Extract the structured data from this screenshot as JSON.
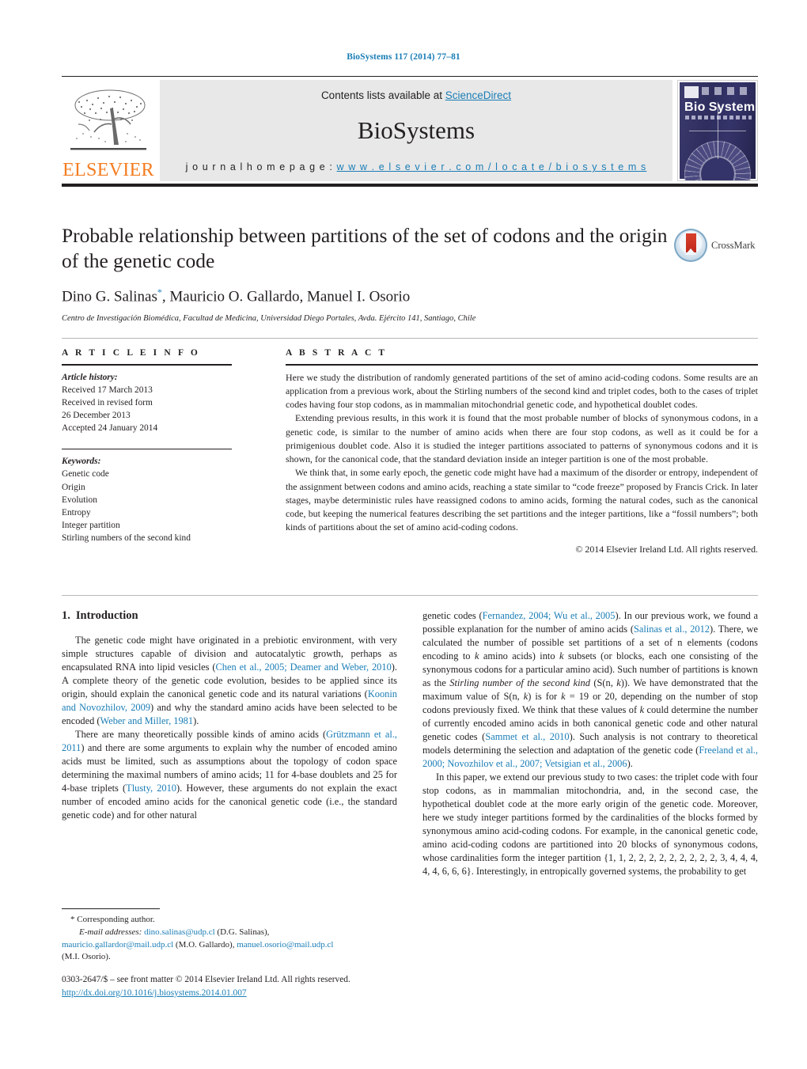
{
  "running_head": "BioSystems 117 (2014) 77–81",
  "masthead": {
    "contents_prefix": "Contents lists available at ",
    "sciencedirect": "ScienceDirect",
    "journal_name": "BioSystems",
    "homepage_prefix": "j o u r n a l   h o m e p a g e :   ",
    "homepage_url": "w w w . e l s e v i e r . c o m / l o c a t e / b i o s y s t e m s",
    "publisher_logo_text": "ELSEVIER",
    "cover_title_a": "Bio",
    "cover_title_b": "Systems",
    "accent_link": "#1a7db6",
    "accent_orange": "#f57c20"
  },
  "article": {
    "title": "Probable relationship between partitions of the set of codons and the origin of the genetic code",
    "authors": "Dino G. Salinas",
    "corresponding_marker": "*",
    "authors_rest": ", Mauricio O. Gallardo, Manuel I. Osorio",
    "affiliation": "Centro de Investigación Biomédica, Facultad de Medicina, Universidad Diego Portales, Avda. Ejército 141, Santiago, Chile",
    "crossmark_label": "CrossMark"
  },
  "article_info": {
    "heading": "A R T I C L E    I N F O",
    "history_label": "Article history:",
    "history": [
      "Received 17 March 2013",
      "Received in revised form",
      "26 December 2013",
      "Accepted 24 January 2014"
    ],
    "keywords_label": "Keywords:",
    "keywords": [
      "Genetic code",
      "Origin",
      "Evolution",
      "Entropy",
      "Integer partition",
      "Stirling numbers of the second kind"
    ]
  },
  "abstract": {
    "heading": "A B S T R A C T",
    "paragraphs": [
      "Here we study the distribution of randomly generated partitions of the set of amino acid-coding codons. Some results are an application from a previous work, about the Stirling numbers of the second kind and triplet codes, both to the cases of triplet codes having four stop codons, as in mammalian mitochondrial genetic code, and hypothetical doublet codes.",
      "Extending previous results, in this work it is found that the most probable number of blocks of synonymous codons, in a genetic code, is similar to the number of amino acids when there are four stop codons, as well as it could be for a primigenious doublet code. Also it is studied the integer partitions associated to patterns of synonymous codons and it is shown, for the canonical code, that the standard deviation inside an integer partition is one of the most probable.",
      "We think that, in some early epoch, the genetic code might have had a maximum of the disorder or entropy, independent of the assignment between codons and amino acids, reaching a state similar to “code freeze” proposed by Francis Crick. In later stages, maybe deterministic rules have reassigned codons to amino acids, forming the natural codes, such as the canonical code, but keeping the numerical features describing the set partitions and the integer partitions, like a “fossil numbers”; both kinds of partitions about the set of amino acid-coding codons."
    ],
    "copyright": "© 2014 Elsevier Ireland Ltd. All rights reserved."
  },
  "body": {
    "section_number": "1.",
    "section_title": "Introduction",
    "left_paragraphs": [
      {
        "parts": [
          {
            "t": "The genetic code might have originated in a prebiotic environment, with very simple structures capable of division and autocatalytic growth, perhaps as encapsulated RNA into lipid vesicles (",
            "k": "plain"
          },
          {
            "t": "Chen et al., 2005; Deamer and Weber, 2010",
            "k": "ref"
          },
          {
            "t": "). A complete theory of the genetic code evolution, besides to be applied since its origin, should explain the canonical genetic code and its natural variations (",
            "k": "plain"
          },
          {
            "t": "Koonin and Novozhilov, 2009",
            "k": "ref"
          },
          {
            "t": ") and why the standard amino acids have been selected to be encoded (",
            "k": "plain"
          },
          {
            "t": "Weber and Miller, 1981",
            "k": "ref"
          },
          {
            "t": ").",
            "k": "plain"
          }
        ]
      },
      {
        "parts": [
          {
            "t": "There are many theoretically possible kinds of amino acids (",
            "k": "plain"
          },
          {
            "t": "Grützmann et al., 2011",
            "k": "ref"
          },
          {
            "t": ") and there are some arguments to explain why the number of encoded amino acids must be limited, such as assumptions about the topology of codon space determining the maximal numbers of amino acids; 11 for 4-base doublets and 25 for 4-base triplets (",
            "k": "plain"
          },
          {
            "t": "Tlusty, 2010",
            "k": "ref"
          },
          {
            "t": "). However, these arguments do not explain the exact number of encoded amino acids for the canonical genetic code (i.e., the standard genetic code) and for other natural",
            "k": "plain"
          }
        ]
      }
    ],
    "right_paragraphs": [
      {
        "parts": [
          {
            "t": "genetic codes (",
            "k": "plain"
          },
          {
            "t": "Fernandez, 2004; Wu et al., 2005",
            "k": "ref"
          },
          {
            "t": "). In our previous work, we found a possible explanation for the number of amino acids (",
            "k": "plain"
          },
          {
            "t": "Salinas et al., 2012",
            "k": "ref"
          },
          {
            "t": "). There, we calculated the number of possible set partitions of a set of n elements (codons encoding to ",
            "k": "plain"
          },
          {
            "t": "k",
            "k": "it"
          },
          {
            "t": " amino acids) into ",
            "k": "plain"
          },
          {
            "t": "k",
            "k": "it"
          },
          {
            "t": " subsets (or blocks, each one consisting of the synonymous codons for a particular amino acid). Such number of partitions is known as the ",
            "k": "plain"
          },
          {
            "t": "Stirling number of the second kind",
            "k": "it"
          },
          {
            "t": " (S(n, ",
            "k": "plain"
          },
          {
            "t": "k",
            "k": "it"
          },
          {
            "t": ")). We have demonstrated that the maximum value of S(n, ",
            "k": "plain"
          },
          {
            "t": "k",
            "k": "it"
          },
          {
            "t": ") is for ",
            "k": "plain"
          },
          {
            "t": "k",
            "k": "it"
          },
          {
            "t": " = 19 or 20, depending on the number of stop codons previously fixed. We think that these values of ",
            "k": "plain"
          },
          {
            "t": "k",
            "k": "it"
          },
          {
            "t": " could determine the number of currently encoded amino acids in both canonical genetic code and other natural genetic codes (",
            "k": "plain"
          },
          {
            "t": "Sammet et al., 2010",
            "k": "ref"
          },
          {
            "t": "). Such analysis is not contrary to theoretical models determining the selection and adaptation of the genetic code (",
            "k": "plain"
          },
          {
            "t": "Freeland et al., 2000; Novozhilov et al., 2007; Vetsigian et al., 2006",
            "k": "ref"
          },
          {
            "t": ").",
            "k": "plain"
          }
        ]
      },
      {
        "parts": [
          {
            "t": "In this paper, we extend our previous study to two cases: the triplet code with four stop codons, as in mammalian mitochondria, and, in the second case, the hypothetical doublet code at the more early origin of the genetic code. Moreover, here we study integer partitions formed by the cardinalities of the blocks formed by synonymous amino acid-coding codons. For example, in the canonical genetic code, amino acid-coding codons are partitioned into 20 blocks of synonymous codons, whose cardinalities form the integer partition {1, 1, 2, 2, 2, 2, 2, 2, 2, 2, 2, 3, 4, 4, 4, 4, 4, 6, 6, 6}. Interestingly, in entropically governed systems, the probability to get",
            "k": "plain"
          }
        ]
      }
    ]
  },
  "footnote": {
    "corresponding": "Corresponding author.",
    "corresponding_marker": "*",
    "email_label": "E-mail addresses:",
    "emails": [
      {
        "addr": "dino.salinas@udp.cl",
        "who": "(D.G. Salinas),"
      },
      {
        "addr": "mauricio.gallardor@mail.udp.cl",
        "who": "(M.O. Gallardo),"
      },
      {
        "addr": "manuel.osorio@mail.udp.cl",
        "who": "(M.I. Osorio)."
      }
    ]
  },
  "imprint": {
    "line1": "0303-2647/$ – see front matter © 2014 Elsevier Ireland Ltd. All rights reserved.",
    "doi": "http://dx.doi.org/10.1016/j.biosystems.2014.01.007"
  }
}
